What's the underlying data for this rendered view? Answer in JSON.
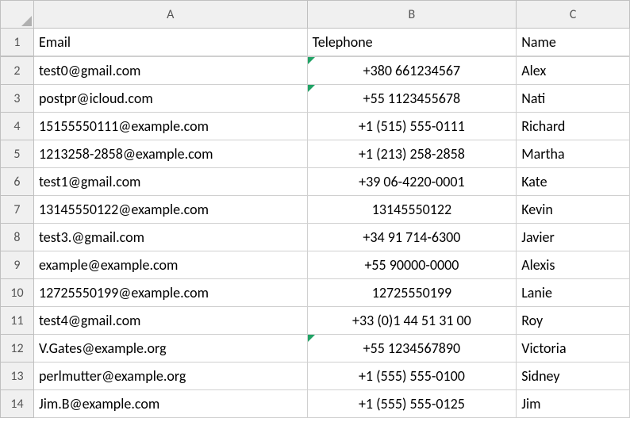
{
  "columns": {
    "A": "A",
    "B": "B",
    "C": "C"
  },
  "rowNumbers": [
    "1",
    "2",
    "3",
    "4",
    "5",
    "6",
    "7",
    "8",
    "9",
    "10",
    "11",
    "12",
    "13",
    "14"
  ],
  "headers": {
    "email": "Email",
    "telephone": "Telephone",
    "name": "Name"
  },
  "rows": [
    {
      "email": "test0@gmail.com",
      "telephone": "+380 661234567",
      "name": "Alex",
      "telFlag": true
    },
    {
      "email": "postpr@icloud.com",
      "telephone": "+55 1123455678",
      "name": "Nati",
      "telFlag": true
    },
    {
      "email": "15155550111@example.com",
      "telephone": "+1 (515) 555-0111",
      "name": "Richard",
      "telFlag": false
    },
    {
      "email": "1213258-2858@example.com",
      "telephone": "+1 (213) 258-2858",
      "name": "Martha",
      "telFlag": false
    },
    {
      "email": "test1@gmail.com",
      "telephone": "+39 06-4220-0001",
      "name": "Kate",
      "telFlag": false
    },
    {
      "email": "13145550122@example.com",
      "telephone": "13145550122",
      "name": "Kevin",
      "telFlag": false
    },
    {
      "email": "test3.@gmail.com",
      "telephone": "+34 91 714-6300",
      "name": "Javier",
      "telFlag": false
    },
    {
      "email": "example@example.com",
      "telephone": "+55 90000-0000",
      "name": "Alexis",
      "telFlag": false
    },
    {
      "email": "12725550199@example.com",
      "telephone": "12725550199",
      "name": "Lanie",
      "telFlag": false
    },
    {
      "email": "test4@gmail.com",
      "telephone": "+33 (0)1 44 51 31 00",
      "name": "Roy",
      "telFlag": false
    },
    {
      "email": "V.Gates@example.org",
      "telephone": "+55 1234567890",
      "name": "Victoria",
      "telFlag": true
    },
    {
      "email": "perlmutter@example.org",
      "telephone": "+1 (555) 555-0100",
      "name": "Sidney",
      "telFlag": false
    },
    {
      "email": "Jim.B@example.com",
      "telephone": "+1 (555) 555-0125",
      "name": "Jim",
      "telFlag": false
    }
  ]
}
